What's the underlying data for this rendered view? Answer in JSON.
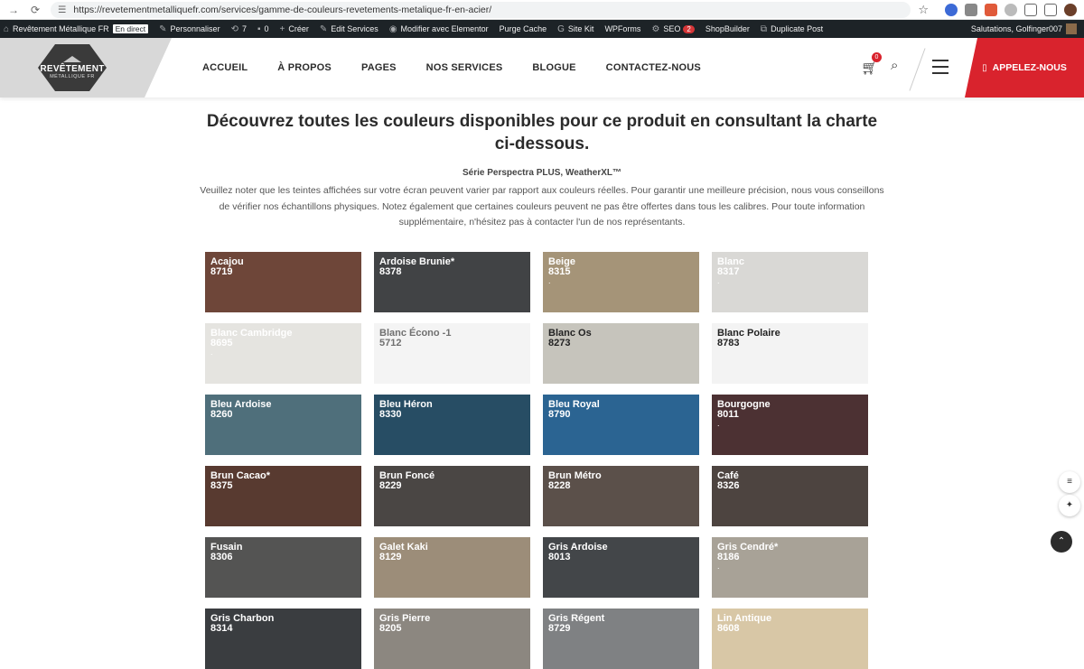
{
  "browser": {
    "url": "https://revetementmetalliquefr.com/services/gamme-de-couleurs-revetements-metalique-fr-en-acier/"
  },
  "adminbar": {
    "site_name": "Revêtement Métallique FR",
    "live": "En direct",
    "customize": "Personnaliser",
    "updates": "7",
    "comments": "0",
    "new": "Créer",
    "edit": "Edit Services",
    "elementor": "Modifier avec Elementor",
    "purge": "Purge Cache",
    "sitekit": "Site Kit",
    "wpforms": "WPForms",
    "seo": "SEO",
    "seo_count": "2",
    "shopbuilder": "ShopBuilder",
    "duplicate": "Duplicate Post",
    "greeting": "Salutations, Golfinger007"
  },
  "logo": {
    "line1": "REVÊTEMENT",
    "line2": "MÉTALLIQUE FR"
  },
  "nav": {
    "items": [
      "ACCUEIL",
      "À PROPOS",
      "PAGES",
      "NOS SERVICES",
      "BLOGUE",
      "CONTACTEZ-NOUS"
    ],
    "cart_count": "0",
    "call_label": "APPELEZ-NOUS"
  },
  "main": {
    "heading": "Découvrez toutes les couleurs disponibles pour ce produit en consultant la charte ci-dessous.",
    "series": "Série Perspectra PLUS, WeatherXL™",
    "note": "Veuillez noter que les teintes affichées sur votre écran peuvent varier par rapport aux couleurs réelles. Pour garantir une meilleure précision, nous vous conseillons de vérifier nos échantillons physiques. Notez également que certaines couleurs peuvent ne pas être offertes dans tous les calibres. Pour toute information supplémentaire, n'hésitez pas à contacter l'un de nos représentants."
  },
  "swatches": [
    {
      "name": "Acajou",
      "code": "8719",
      "bg": "#6e4639",
      "fg": "#ffffff"
    },
    {
      "name": "Ardoise Brunie*",
      "code": "8378",
      "bg": "#414345",
      "fg": "#ffffff"
    },
    {
      "name": "Beige",
      "code": "8315",
      "bg": "#a59478",
      "fg": "#ffffff",
      "dot": "."
    },
    {
      "name": "Blanc",
      "code": "8317",
      "bg": "#d9d8d5",
      "fg": "#ffffff",
      "dot": "."
    },
    {
      "name": "Blanc Cambridge",
      "code": "8695",
      "bg": "#e5e4e0",
      "fg": "#ffffff",
      "dot": "."
    },
    {
      "name": "Blanc Écono -1",
      "code": "5712",
      "bg": "#f4f4f4",
      "fg": "#707070"
    },
    {
      "name": "Blanc Os",
      "code": "8273",
      "bg": "#c6c4bc",
      "fg": "#222222"
    },
    {
      "name": "Blanc Polaire",
      "code": "8783",
      "bg": "#f3f3f3",
      "fg": "#222222"
    },
    {
      "name": "Bleu Ardoise",
      "code": "8260",
      "bg": "#4f6f7b",
      "fg": "#ffffff"
    },
    {
      "name": "Bleu Héron",
      "code": "8330",
      "bg": "#274d64",
      "fg": "#ffffff"
    },
    {
      "name": "Bleu Royal",
      "code": "8790",
      "bg": "#2b6492",
      "fg": "#ffffff"
    },
    {
      "name": "Bourgogne",
      "code": "8011",
      "bg": "#4c3133",
      "fg": "#ffffff",
      "dot": "."
    },
    {
      "name": "Brun Cacao*",
      "code": "8375",
      "bg": "#583a30",
      "fg": "#ffffff"
    },
    {
      "name": "Brun Foncé",
      "code": "8229",
      "bg": "#4a4644",
      "fg": "#ffffff"
    },
    {
      "name": "Brun Métro",
      "code": "8228",
      "bg": "#5b504a",
      "fg": "#ffffff"
    },
    {
      "name": "Café",
      "code": "8326",
      "bg": "#4d4440",
      "fg": "#ffffff"
    },
    {
      "name": "Fusain",
      "code": "8306",
      "bg": "#545453",
      "fg": "#ffffff"
    },
    {
      "name": "Galet Kaki",
      "code": "8129",
      "bg": "#9c8d79",
      "fg": "#ffffff"
    },
    {
      "name": "Gris Ardoise",
      "code": "8013",
      "bg": "#434649",
      "fg": "#ffffff"
    },
    {
      "name": "Gris Cendré*",
      "code": "8186",
      "bg": "#a8a297",
      "fg": "#ffffff",
      "dot": "."
    },
    {
      "name": "Gris Charbon",
      "code": "8314",
      "bg": "#3a3d40",
      "fg": "#ffffff"
    },
    {
      "name": "Gris Pierre",
      "code": "8205",
      "bg": "#8c8780",
      "fg": "#ffffff"
    },
    {
      "name": "Gris Régent",
      "code": "8729",
      "bg": "#7f8183",
      "fg": "#ffffff"
    },
    {
      "name": "Lin Antique",
      "code": "8608",
      "bg": "#d8c7a6",
      "fg": "#ffffff"
    }
  ]
}
